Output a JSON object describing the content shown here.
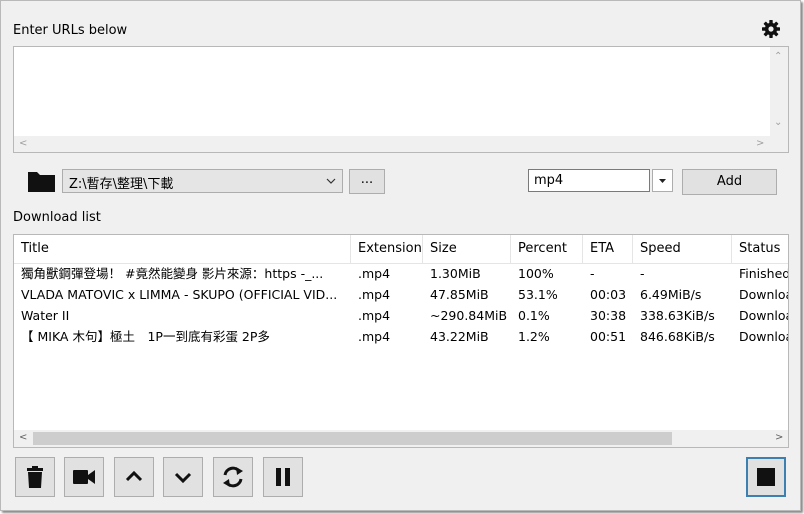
{
  "urls": {
    "label": "Enter URLs below",
    "value": ""
  },
  "settings_icon": "gear-icon",
  "folder": {
    "icon": "folder-icon",
    "path": "Z:\\暫存\\整理\\下載",
    "browse_label": "..."
  },
  "format": {
    "value": "mp4",
    "add_label": "Add"
  },
  "download_list": {
    "label": "Download list",
    "columns": [
      "Title",
      "Extension",
      "Size",
      "Percent",
      "ETA",
      "Speed",
      "Status"
    ],
    "rows": [
      [
        "獨角獸鋼彈登場！ #竟然能變身 影片來源：https -_...",
        ".mp4",
        "1.30MiB",
        "100%",
        "-",
        "-",
        "Finished"
      ],
      [
        "VLADA MATOVIC x LIMMA - SKUPO (OFFICIAL VID...",
        ".mp4",
        "47.85MiB",
        "53.1%",
        "00:03",
        "6.49MiB/s",
        "Downloading"
      ],
      [
        "Water II",
        ".mp4",
        "~290.84MiB",
        "0.1%",
        "30:38",
        "338.63KiB/s",
        "Downloading"
      ],
      [
        "【 MIKA 木句】極土　1P一到底有彩蛋 2P多",
        ".mp4",
        "43.22MiB",
        "1.2%",
        "00:51",
        "846.68KiB/s",
        "Downloading"
      ]
    ]
  },
  "toolbar": {
    "delete_icon": "trash-icon",
    "play_icon": "video-camera-icon",
    "move_up_icon": "chevron-up-icon",
    "move_down_icon": "chevron-down-icon",
    "reload_icon": "refresh-icon",
    "pause_icon": "pause-icon",
    "stop_icon": "stop-icon"
  }
}
